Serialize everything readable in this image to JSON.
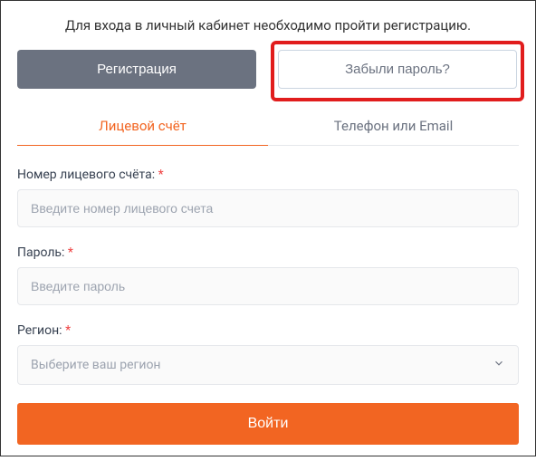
{
  "intro": "Для входа в личный кабинет необходимо пройти регистрацию.",
  "buttons": {
    "register": "Регистрация",
    "forgot": "Забыли пароль?"
  },
  "tabs": {
    "account": "Лицевой счёт",
    "phone_email": "Телефон или Email"
  },
  "form": {
    "account_label": "Номер лицевого счёта:",
    "account_placeholder": "Введите номер лицевого счета",
    "password_label": "Пароль:",
    "password_placeholder": "Введите пароль",
    "region_label": "Регион:",
    "region_placeholder": "Выберите ваш регион",
    "required_mark": "*"
  },
  "submit": "Войти"
}
